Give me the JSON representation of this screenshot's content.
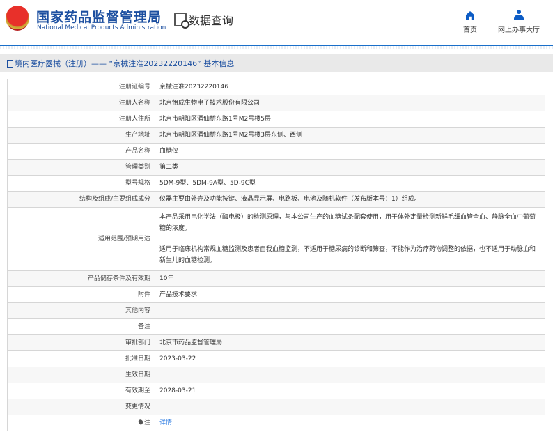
{
  "header": {
    "title": "国家药品监督管理局",
    "subtitle": "National Medical Products Administration",
    "query": "数据查询",
    "nav": [
      {
        "label": "首页",
        "icon": "home-icon"
      },
      {
        "label": "网上办事大厅",
        "icon": "user-icon"
      }
    ]
  },
  "breadcrumb": "境内医疗器械（注册）—— “京械注准20232220146” 基本信息",
  "rows": [
    {
      "label": "注册证编号",
      "value": "京械注准20232220146"
    },
    {
      "label": "注册人名称",
      "value": "北京怡成生物电子技术股份有限公司"
    },
    {
      "label": "注册人住所",
      "value": "北京市朝阳区酒仙桥东路1号M2号楼5层"
    },
    {
      "label": "生产地址",
      "value": "北京市朝阳区酒仙桥东路1号M2号楼3层东侧、西侧"
    },
    {
      "label": "产品名称",
      "value": "血糖仪"
    },
    {
      "label": "管理类别",
      "value": "第二类"
    },
    {
      "label": "型号规格",
      "value": "5DM-9型、5DM-9A型、5D-9C型"
    },
    {
      "label": "结构及组成/主要组成成分",
      "value": "仪器主要由外壳及功能按键、液晶显示屏、电路板、电池及随机软件（发布版本号：1）组成。"
    },
    {
      "label": "适用范围/预期用途",
      "value": "本产品采用电化学法（酶电极）的检测原理，与本公司生产的血糖试条配套使用，用于体外定量检测新鲜毛细血管全血、静脉全血中葡萄糖的浓度。",
      "value2": "适用于临床机构常规血糖监测及患者自我血糖监测，不适用于糖尿病的诊断和筛查，不能作为治疗药物调整的依据，也不适用于动脉血和新生儿的血糖检测。"
    },
    {
      "label": "产品储存条件及有效期",
      "value": "10年"
    },
    {
      "label": "附件",
      "value": "产品技术要求"
    },
    {
      "label": "其他内容",
      "value": ""
    },
    {
      "label": "备注",
      "value": ""
    },
    {
      "label": "审批部门",
      "value": "北京市药品监督管理局"
    },
    {
      "label": "批准日期",
      "value": "2023-03-22"
    },
    {
      "label": "生效日期",
      "value": ""
    },
    {
      "label": "有效期至",
      "value": "2028-03-21"
    },
    {
      "label": "变更情况",
      "value": ""
    },
    {
      "label": "注",
      "value": "详情"
    }
  ]
}
